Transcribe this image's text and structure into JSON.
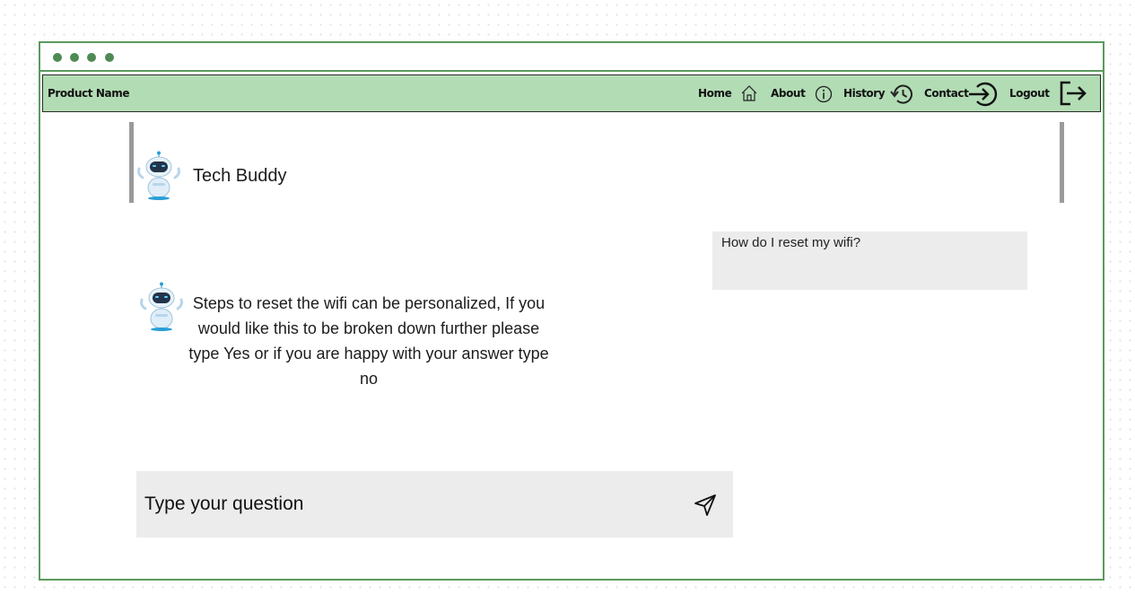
{
  "window": {
    "dots": [
      "dot",
      "dot",
      "dot",
      "dot"
    ]
  },
  "navbar": {
    "product_name": "Product Name",
    "items": [
      {
        "label": "Home",
        "icon": "home-icon"
      },
      {
        "label": "About",
        "icon": "info-icon"
      },
      {
        "label": "History",
        "icon": "history-icon"
      },
      {
        "label": "Contact",
        "icon": "login-arrow-icon"
      },
      {
        "label": "Logout",
        "icon": "logout-icon"
      }
    ]
  },
  "chat": {
    "bot_name": "Tech Buddy",
    "user_message": "How do I reset my wifi?",
    "bot_message": "Steps to reset the wifi can be personalized, If you would like this to be broken down further please type Yes or if you are happy with your answer type no"
  },
  "input": {
    "placeholder": "Type your question",
    "send_icon": "send-icon"
  },
  "colors": {
    "frame_border": "#5b9a5e",
    "navbar_bg": "#b2dcb4",
    "bubble_bg": "#ececec",
    "bot_accent": "#2a9fd6"
  }
}
